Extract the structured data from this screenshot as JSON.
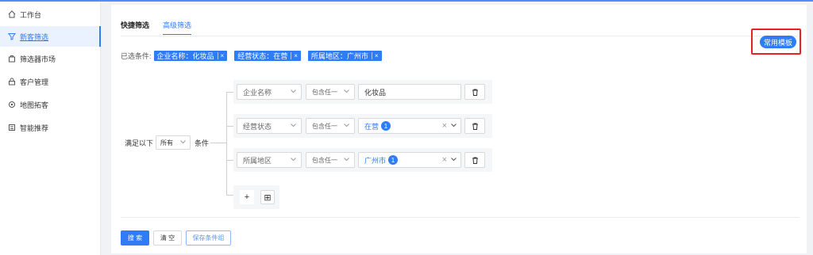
{
  "colors": {
    "accent": "#2f7cf6",
    "highlight_box": "#e82222",
    "sidebar_active_bg": "#eaf2ff"
  },
  "sidebar": {
    "items": [
      {
        "label": "工作台",
        "icon": "home-icon"
      },
      {
        "label": "新客筛选",
        "icon": "filter-icon",
        "active": true
      },
      {
        "label": "筛选器市场",
        "icon": "shop-icon"
      },
      {
        "label": "客户管理",
        "icon": "lock-icon"
      },
      {
        "label": "地图拓客",
        "icon": "map-icon"
      },
      {
        "label": "智能推荐",
        "icon": "recommend-icon"
      }
    ]
  },
  "tabs": [
    {
      "label": "快捷筛选",
      "active": false
    },
    {
      "label": "高级筛选",
      "active": true
    }
  ],
  "template_button": "常用模板",
  "selected": {
    "label": "已选条件:",
    "chips": [
      {
        "text": "企业名称：化妆品"
      },
      {
        "text": "经营状态：在营"
      },
      {
        "text": "所属地区：广州市"
      }
    ],
    "chip_close": "×"
  },
  "match": {
    "prefix": "满足以下",
    "value": "所有",
    "suffix": "条件"
  },
  "conditions": [
    {
      "field": "企业名称",
      "operator": "包含任一",
      "value": "化妆品",
      "value_type": "text"
    },
    {
      "field": "经营状态",
      "operator": "包含任一",
      "value": "在营",
      "count": "1",
      "value_type": "tag"
    },
    {
      "field": "所属地区",
      "operator": "包含任一",
      "value": "广州市",
      "count": "1",
      "value_type": "tag"
    }
  ],
  "add_buttons": {
    "add_condition": "+",
    "add_group": "⊞"
  },
  "actions": {
    "search": "搜 索",
    "clear": "清 空",
    "save": "保存条件组"
  }
}
